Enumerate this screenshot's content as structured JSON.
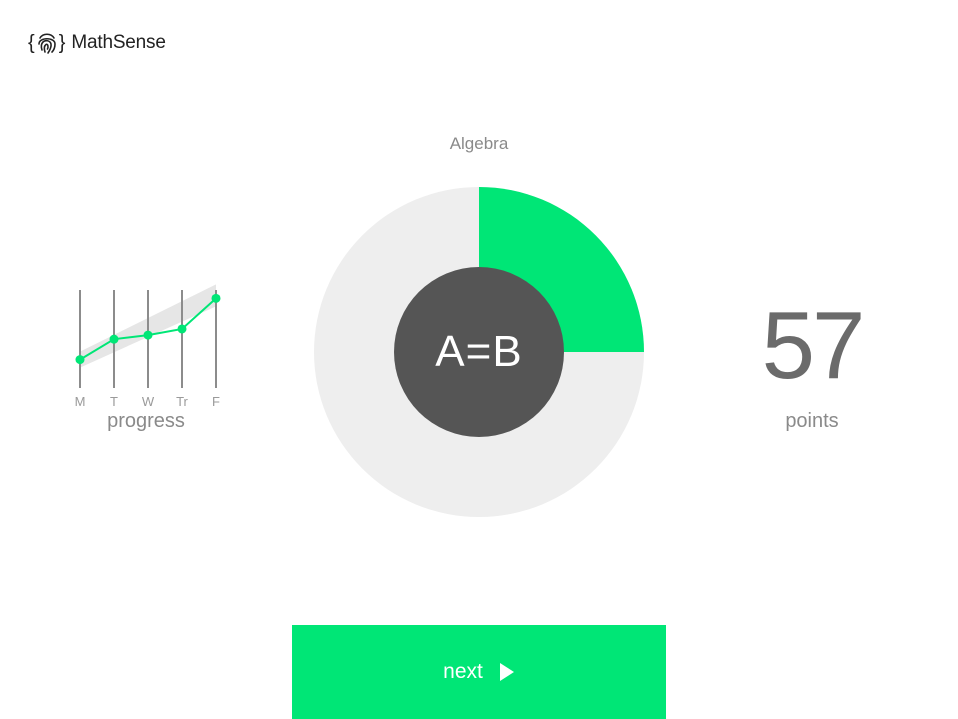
{
  "app": {
    "name": "MathSense",
    "logo_icon": "fingerprint-icon"
  },
  "colors": {
    "accent": "#00e676",
    "ring_track": "#eeeeee",
    "center": "#555555"
  },
  "lesson": {
    "subject": "Algebra",
    "symbol": "A=B",
    "completion": 0.25
  },
  "progress": {
    "label": "progress",
    "days": [
      "M",
      "T",
      "W",
      "Tr",
      "F"
    ],
    "values": [
      1,
      2,
      2.2,
      2.5,
      4
    ]
  },
  "score": {
    "value": "57",
    "label": "points"
  },
  "actions": {
    "next_label": "next",
    "next_icon": "play-icon"
  }
}
